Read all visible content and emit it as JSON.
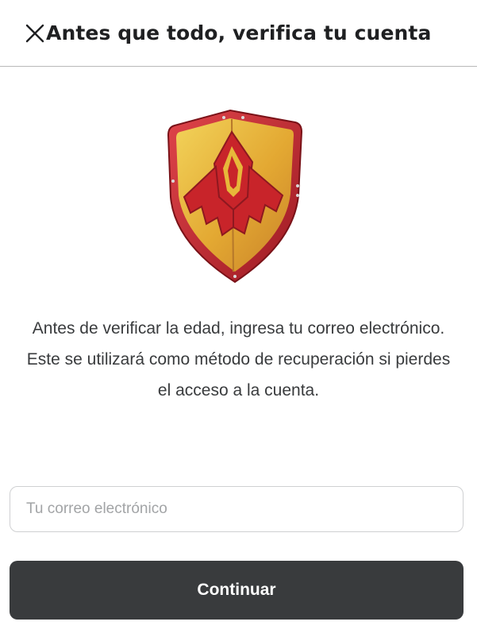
{
  "header": {
    "title": "Antes que todo, verifica tu cuenta",
    "close_icon": "close-icon"
  },
  "illustration": {
    "icon": "shield-icon",
    "colors": {
      "rim": "#c8242a",
      "face": "#e7b83a",
      "emblem": "#c8242a"
    }
  },
  "description": "Antes de verificar la edad, ingresa tu correo electrónico. Este se utilizará como método de recuperación si pierdes el acceso a la cuenta.",
  "email": {
    "placeholder": "Tu correo electrónico",
    "value": ""
  },
  "continue_button": {
    "label": "Continuar",
    "color": "#393b3d"
  }
}
